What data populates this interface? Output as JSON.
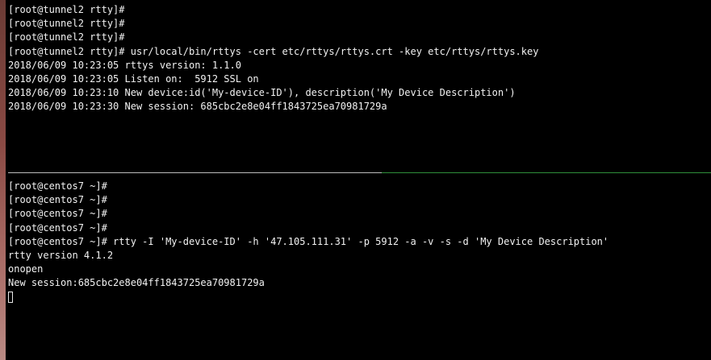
{
  "top_pane": {
    "lines": [
      "[root@tunnel2 rtty]#",
      "[root@tunnel2 rtty]#",
      "[root@tunnel2 rtty]#",
      "[root@tunnel2 rtty]# usr/local/bin/rttys -cert etc/rttys/rttys.crt -key etc/rttys/rttys.key",
      "2018/06/09 10:23:05 rttys version: 1.1.0",
      "2018/06/09 10:23:05 Listen on:  5912 SSL on",
      "2018/06/09 10:23:10 New device:id('My-device-ID'), description('My Device Description')",
      "2018/06/09 10:23:30 New session: 685cbc2e8e04ff1843725ea70981729a"
    ]
  },
  "bottom_pane": {
    "lines": [
      "[root@centos7 ~]#",
      "[root@centos7 ~]#",
      "[root@centos7 ~]#",
      "[root@centos7 ~]#",
      "[root@centos7 ~]# rtty -I 'My-device-ID' -h '47.105.111.31' -p 5912 -a -v -s -d 'My Device Description'",
      "rtty version 4.1.2",
      "onopen",
      "New session:685cbc2e8e04ff1843725ea70981729a"
    ]
  },
  "colors": {
    "background": "#000000",
    "text": "#f2f2f2",
    "divider_active": "#2f8f3a",
    "divider_inactive": "#bdbdbd"
  }
}
